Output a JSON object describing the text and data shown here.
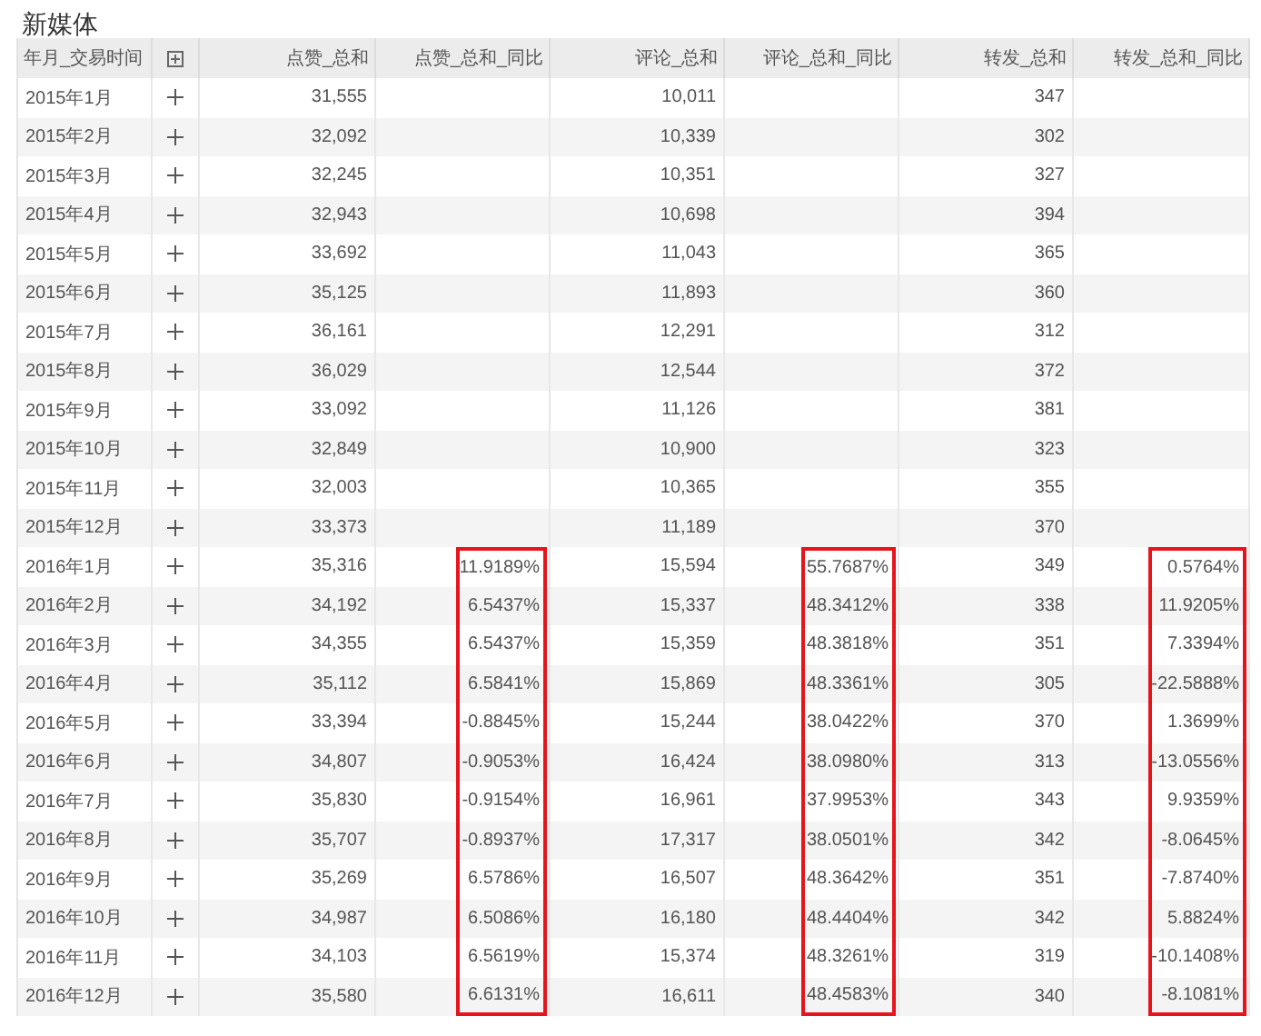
{
  "title": "新媒体",
  "table": {
    "columns": [
      "年月_交易时间",
      "点赞_总和",
      "点赞_总和_同比",
      "评论_总和",
      "评论_总和_同比",
      "转发_总和",
      "转发_总和_同比"
    ],
    "rows": [
      {
        "period": "2015年1月",
        "likes_total": "31,555",
        "comments_total": "10,011",
        "shares_total": "347"
      },
      {
        "period": "2015年2月",
        "likes_total": "32,092",
        "comments_total": "10,339",
        "shares_total": "302"
      },
      {
        "period": "2015年3月",
        "likes_total": "32,245",
        "comments_total": "10,351",
        "shares_total": "327"
      },
      {
        "period": "2015年4月",
        "likes_total": "32,943",
        "comments_total": "10,698",
        "shares_total": "394"
      },
      {
        "period": "2015年5月",
        "likes_total": "33,692",
        "comments_total": "11,043",
        "shares_total": "365"
      },
      {
        "period": "2015年6月",
        "likes_total": "35,125",
        "comments_total": "11,893",
        "shares_total": "360"
      },
      {
        "period": "2015年7月",
        "likes_total": "36,161",
        "comments_total": "12,291",
        "shares_total": "312"
      },
      {
        "period": "2015年8月",
        "likes_total": "36,029",
        "comments_total": "12,544",
        "shares_total": "372"
      },
      {
        "period": "2015年9月",
        "likes_total": "33,092",
        "comments_total": "11,126",
        "shares_total": "381"
      },
      {
        "period": "2015年10月",
        "likes_total": "32,849",
        "comments_total": "10,900",
        "shares_total": "323"
      },
      {
        "period": "2015年11月",
        "likes_total": "32,003",
        "comments_total": "10,365",
        "shares_total": "355"
      },
      {
        "period": "2015年12月",
        "likes_total": "33,373",
        "comments_total": "11,189",
        "shares_total": "370"
      },
      {
        "period": "2016年1月",
        "likes_total": "35,316",
        "likes_yoy": {
          "text": "11.9189%",
          "highlighted": true
        },
        "comments_total": "15,594",
        "comments_yoy": {
          "text": "55.7687%",
          "highlighted": true
        },
        "shares_total": "349",
        "shares_yoy": {
          "text": "0.5764%",
          "highlighted": true
        }
      },
      {
        "period": "2016年2月",
        "likes_total": "34,192",
        "likes_yoy": {
          "text": "6.5437%",
          "highlighted": true
        },
        "comments_total": "15,337",
        "comments_yoy": {
          "text": "48.3412%",
          "highlighted": true
        },
        "shares_total": "338",
        "shares_yoy": {
          "text": "11.9205%",
          "highlighted": true
        }
      },
      {
        "period": "2016年3月",
        "likes_total": "34,355",
        "likes_yoy": {
          "text": "6.5437%",
          "highlighted": true
        },
        "comments_total": "15,359",
        "comments_yoy": {
          "text": "48.3818%",
          "highlighted": true
        },
        "shares_total": "351",
        "shares_yoy": {
          "text": "7.3394%",
          "highlighted": true
        }
      },
      {
        "period": "2016年4月",
        "likes_total": "35,112",
        "likes_yoy": {
          "text": "6.5841%",
          "highlighted": true
        },
        "comments_total": "15,869",
        "comments_yoy": {
          "text": "48.3361%",
          "highlighted": true
        },
        "shares_total": "305",
        "shares_yoy": {
          "text": "-22.5888%",
          "highlighted": true
        }
      },
      {
        "period": "2016年5月",
        "likes_total": "33,394",
        "likes_yoy": {
          "text": "-0.8845%",
          "highlighted": true
        },
        "comments_total": "15,244",
        "comments_yoy": {
          "text": "38.0422%",
          "highlighted": true
        },
        "shares_total": "370",
        "shares_yoy": {
          "text": "1.3699%",
          "highlighted": true
        }
      },
      {
        "period": "2016年6月",
        "likes_total": "34,807",
        "likes_yoy": {
          "text": "-0.9053%",
          "highlighted": true
        },
        "comments_total": "16,424",
        "comments_yoy": {
          "text": "38.0980%",
          "highlighted": true
        },
        "shares_total": "313",
        "shares_yoy": {
          "text": "-13.0556%",
          "highlighted": true
        }
      },
      {
        "period": "2016年7月",
        "likes_total": "35,830",
        "likes_yoy": {
          "text": "-0.9154%",
          "highlighted": true
        },
        "comments_total": "16,961",
        "comments_yoy": {
          "text": "37.9953%",
          "highlighted": true
        },
        "shares_total": "343",
        "shares_yoy": {
          "text": "9.9359%",
          "highlighted": true
        }
      },
      {
        "period": "2016年8月",
        "likes_total": "35,707",
        "likes_yoy": {
          "text": "-0.8937%",
          "highlighted": true
        },
        "comments_total": "17,317",
        "comments_yoy": {
          "text": "38.0501%",
          "highlighted": true
        },
        "shares_total": "342",
        "shares_yoy": {
          "text": "-8.0645%",
          "highlighted": true
        }
      },
      {
        "period": "2016年9月",
        "likes_total": "35,269",
        "likes_yoy": {
          "text": "6.5786%",
          "highlighted": true
        },
        "comments_total": "16,507",
        "comments_yoy": {
          "text": "48.3642%",
          "highlighted": true
        },
        "shares_total": "351",
        "shares_yoy": {
          "text": "-7.8740%",
          "highlighted": true
        }
      },
      {
        "period": "2016年10月",
        "likes_total": "34,987",
        "likes_yoy": {
          "text": "6.5086%",
          "highlighted": true
        },
        "comments_total": "16,180",
        "comments_yoy": {
          "text": "48.4404%",
          "highlighted": true
        },
        "shares_total": "342",
        "shares_yoy": {
          "text": "5.8824%",
          "highlighted": true
        }
      },
      {
        "period": "2016年11月",
        "likes_total": "34,103",
        "likes_yoy": {
          "text": "6.5619%",
          "highlighted": true
        },
        "comments_total": "15,374",
        "comments_yoy": {
          "text": "48.3261%",
          "highlighted": true
        },
        "shares_total": "319",
        "shares_yoy": {
          "text": "-10.1408%",
          "highlighted": true
        }
      },
      {
        "period": "2016年12月",
        "likes_total": "35,580",
        "likes_yoy": {
          "text": "6.6131%",
          "highlighted": true
        },
        "comments_total": "16,611",
        "comments_yoy": {
          "text": "48.4583%",
          "highlighted": true
        },
        "shares_total": "340",
        "shares_yoy": {
          "text": "-8.1081%",
          "highlighted": true
        }
      }
    ]
  }
}
